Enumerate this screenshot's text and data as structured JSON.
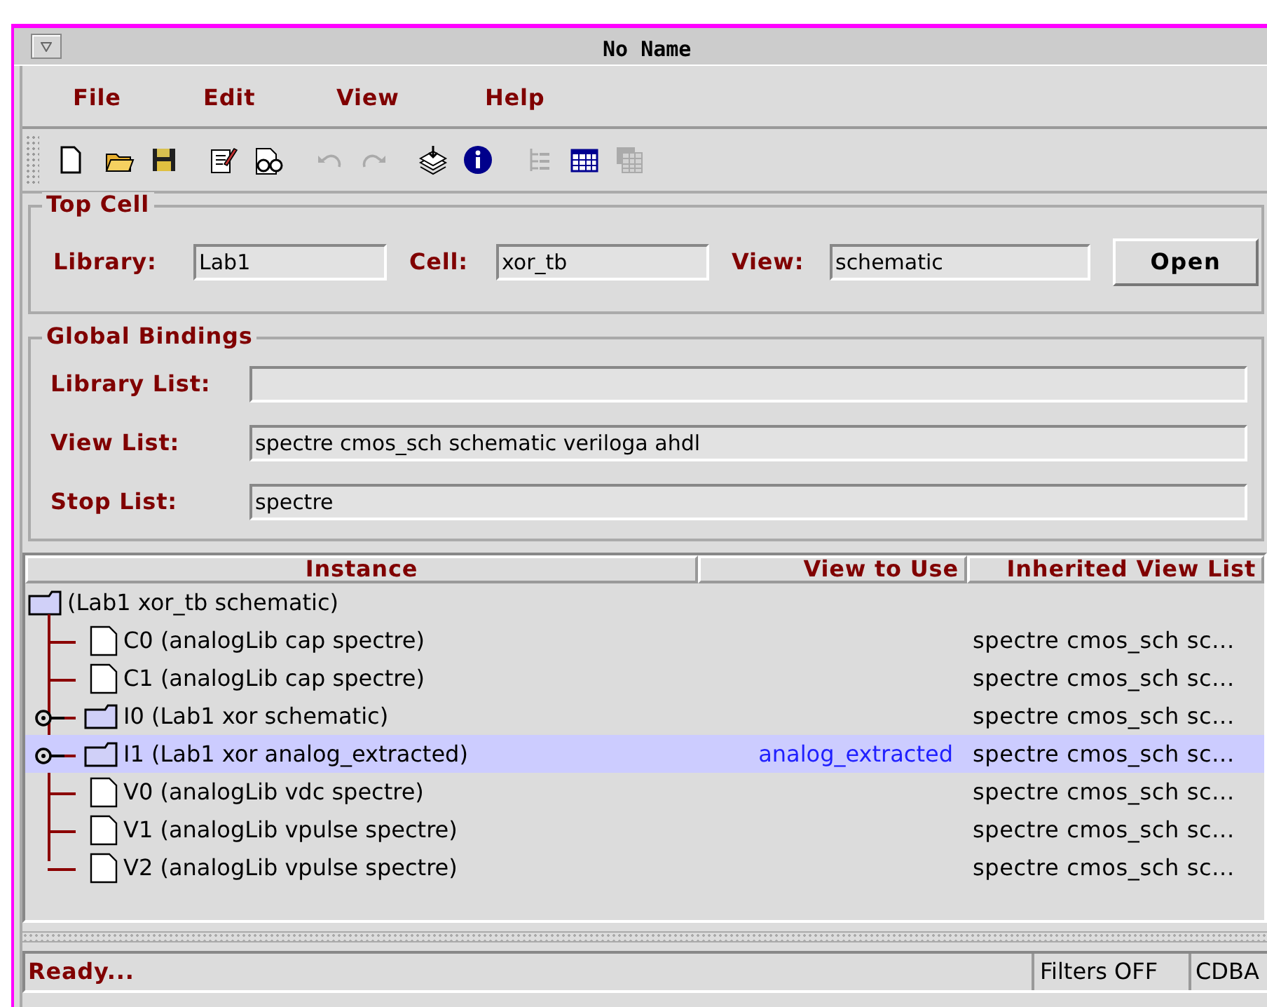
{
  "window": {
    "title": "No Name"
  },
  "menu": [
    "File",
    "Edit",
    "View",
    "Help"
  ],
  "toolbar": [
    {
      "disabled": false
    },
    {
      "disabled": false
    },
    {
      "disabled": false
    },
    {
      "disabled": false
    },
    {
      "disabled": false
    },
    {
      "disabled": true
    },
    {
      "disabled": true
    },
    {
      "disabled": false
    },
    {
      "disabled": false
    },
    {
      "disabled": true
    },
    {
      "disabled": false
    },
    {
      "disabled": true
    }
  ],
  "top_cell": {
    "title": "Top Cell",
    "fields": [
      {
        "label": "Library:",
        "value": "Lab1"
      },
      {
        "label": "Cell:",
        "value": "xor_tb"
      },
      {
        "label": "View:",
        "value": "schematic"
      }
    ],
    "button": "Open"
  },
  "global_bindings": {
    "title": "Global Bindings",
    "fields": [
      {
        "label": "Library List:"
      },
      {
        "label": "View List:",
        "value": "spectre cmos_sch schematic veriloga ahdl"
      },
      {
        "label": "Stop List:",
        "value": "spectre"
      }
    ]
  },
  "table": {
    "columns": [
      "Instance",
      "View to Use",
      "Inherited View List"
    ],
    "root": {
      "text": "(Lab1 xor_tb schematic)",
      "kind": "folder",
      "children": [
        {
          "text": "C0 (analogLib cap spectre)",
          "kind": "leaf",
          "has_children": false,
          "selected": false,
          "inherited": "spectre cmos_sch sc..."
        },
        {
          "text": "C1 (analogLib cap spectre)",
          "kind": "leaf",
          "has_children": false,
          "selected": false,
          "inherited": "spectre cmos_sch sc..."
        },
        {
          "text": "I0 (Lab1 xor schematic)",
          "kind": "folder",
          "has_children": true,
          "selected": false,
          "inherited": "spectre cmos_sch sc..."
        },
        {
          "text": "I1 (Lab1 xor analog_extracted)",
          "kind": "folder",
          "has_children": true,
          "selected": true,
          "view_to_use": "analog_extracted",
          "inherited": "spectre cmos_sch sc..."
        },
        {
          "text": "V0 (analogLib vdc spectre)",
          "kind": "leaf",
          "has_children": false,
          "selected": false,
          "inherited": "spectre cmos_sch sc..."
        },
        {
          "text": "V1 (analogLib vpulse spectre)",
          "kind": "leaf",
          "has_children": false,
          "selected": false,
          "inherited": "spectre cmos_sch sc..."
        },
        {
          "text": "V2 (analogLib vpulse spectre)",
          "kind": "leaf",
          "has_children": false,
          "selected": false,
          "inherited": "spectre cmos_sch sc..."
        }
      ]
    }
  },
  "status_bar": {
    "message": "Ready...",
    "filters": "Filters OFF",
    "mode": "CDBA"
  }
}
